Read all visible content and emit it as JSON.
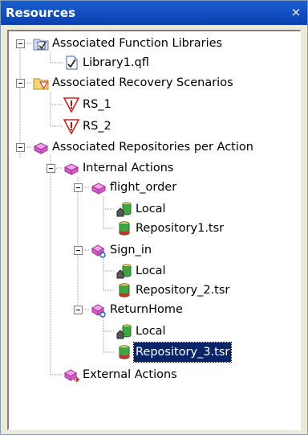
{
  "panel": {
    "title": "Resources",
    "close_glyph": "×"
  },
  "tree": [
    {
      "id": "afl",
      "label": "Associated Function Libraries",
      "icon": "function-libraries-icon",
      "expanded": true
    },
    {
      "id": "lib1",
      "label": "Library1.qfl",
      "icon": "library-file-icon"
    },
    {
      "id": "ars",
      "label": "Associated Recovery Scenarios",
      "icon": "recovery-folder-icon",
      "expanded": true
    },
    {
      "id": "rs1",
      "label": "RS_1",
      "icon": "warning-icon"
    },
    {
      "id": "rs2",
      "label": "RS_2",
      "icon": "warning-icon"
    },
    {
      "id": "arpa",
      "label": "Associated Repositories per Action",
      "icon": "repositories-icon",
      "expanded": true
    },
    {
      "id": "ia",
      "label": "Internal Actions",
      "icon": "action-icon",
      "expanded": true
    },
    {
      "id": "fo",
      "label": "flight_order",
      "icon": "action-icon",
      "expanded": true
    },
    {
      "id": "fo_local",
      "label": "Local",
      "icon": "local-repository-icon"
    },
    {
      "id": "fo_repo",
      "label": "Repository1.tsr",
      "icon": "repository-icon"
    },
    {
      "id": "si",
      "label": "Sign_in",
      "icon": "reusable-action-icon",
      "expanded": true
    },
    {
      "id": "si_local",
      "label": "Local",
      "icon": "local-repository-icon"
    },
    {
      "id": "si_repo",
      "label": "Repository_2.tsr",
      "icon": "repository-icon"
    },
    {
      "id": "rh",
      "label": "ReturnHome",
      "icon": "reusable-action-icon",
      "expanded": true
    },
    {
      "id": "rh_local",
      "label": "Local",
      "icon": "local-repository-icon"
    },
    {
      "id": "rh_repo",
      "label": "Repository_3.tsr",
      "icon": "repository-icon",
      "selected": true
    },
    {
      "id": "ea",
      "label": "External Actions",
      "icon": "external-action-icon"
    }
  ],
  "colors": {
    "titlebar": "#1b5fd1",
    "selection": "#0a246a",
    "tree_lines": "#9a9a9a"
  }
}
